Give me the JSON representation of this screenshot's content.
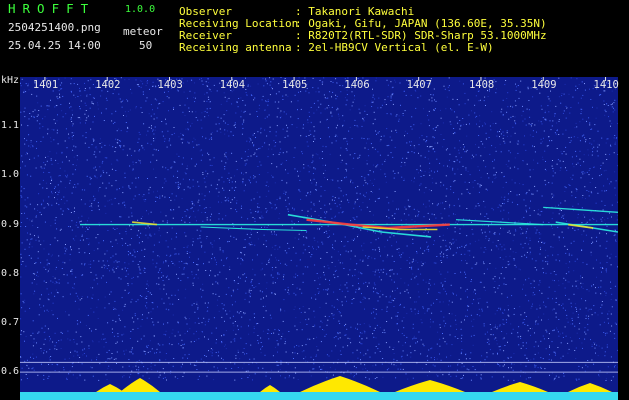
{
  "header": {
    "brand": "HROFFT",
    "version": "1.0.0",
    "filename": "2504251400.png",
    "datetime": "25.04.25 14:00",
    "count_label": "meteor",
    "count_value": "50",
    "fields": [
      {
        "label": "Observer",
        "value": ": Takanori Kawachi"
      },
      {
        "label": "Receiving Location",
        "value": ": Ogaki, Gifu, JAPAN (136.60E, 35.35N)"
      },
      {
        "label": "Receiver",
        "value": ": R820T2(RTL-SDR) SDR-Sharp 53.1000MHz"
      },
      {
        "label": "Receiving antenna",
        "value": ": 2el-HB9CV Vertical (el. E-W)"
      }
    ]
  },
  "chart_data": {
    "type": "heatmap",
    "ylabel": "kHz",
    "y_ticks": [
      "1.1",
      "1.0",
      "0.9",
      "0.8",
      "0.7",
      "0.6"
    ],
    "ylim": [
      0.58,
      1.2
    ],
    "x_ticks": [
      "1401",
      "1402",
      "1403",
      "1404",
      "1405",
      "1406",
      "1407",
      "1408",
      "1409",
      "1410"
    ],
    "xlim": [
      1400.6,
      1410.2
    ],
    "carrier_khz": 0.9,
    "colors": {
      "background": "#0d1a8a",
      "noise_light": "#5a78ff",
      "trace": "#2cf0e0",
      "echo_hot": "#ff3a3a",
      "echo_mid": "#e8e030",
      "level_bar": "#35d8f0",
      "level_peak": "#ffe800"
    }
  }
}
